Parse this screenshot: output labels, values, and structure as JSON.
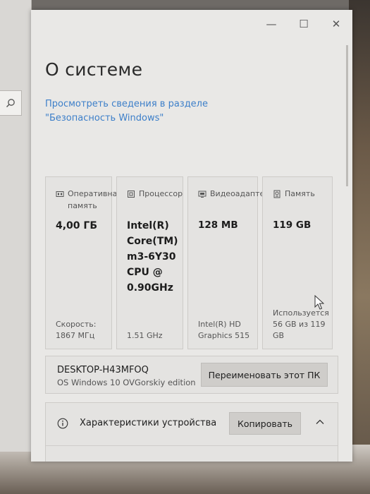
{
  "window": {
    "controls": {
      "minimize": "—",
      "maximize": "☐",
      "close": "✕"
    }
  },
  "left_panel": {
    "search_icon": "⌕"
  },
  "page": {
    "title": "О системе",
    "security_link": "Просмотреть сведения в разделе \"Безопасность Windows\""
  },
  "cards": [
    {
      "icon": "memory-icon",
      "title": "Оперативная память",
      "value": "4,00 ГБ",
      "footer": "Скорость: 1867 МГц"
    },
    {
      "icon": "processor-icon",
      "title": "Процессор",
      "value": "Intel(R) Core(TM) m3-6Y30 CPU @ 0.90GHz",
      "footer": "1.51 GHz"
    },
    {
      "icon": "video-adapter-icon",
      "title": "Видеоадаптер",
      "value": "128 MB",
      "footer": "Intel(R) HD Graphics 515"
    },
    {
      "icon": "storage-icon",
      "title": "Память",
      "value": "119 GB",
      "footer": "Используется 56 GB из 119 GB"
    }
  ],
  "pc": {
    "name": "DESKTOP-H43MFOQ",
    "edition": "OS Windows 10 OVGorskiy edition",
    "rename_button": "Переименовать этот ПК"
  },
  "device_specs": {
    "title": "Характеристики устройства",
    "copy_button": "Копировать"
  },
  "colors": {
    "link": "#3d7fc9",
    "window_bg": "#e9e8e6",
    "card_bg": "#e4e3e1"
  }
}
